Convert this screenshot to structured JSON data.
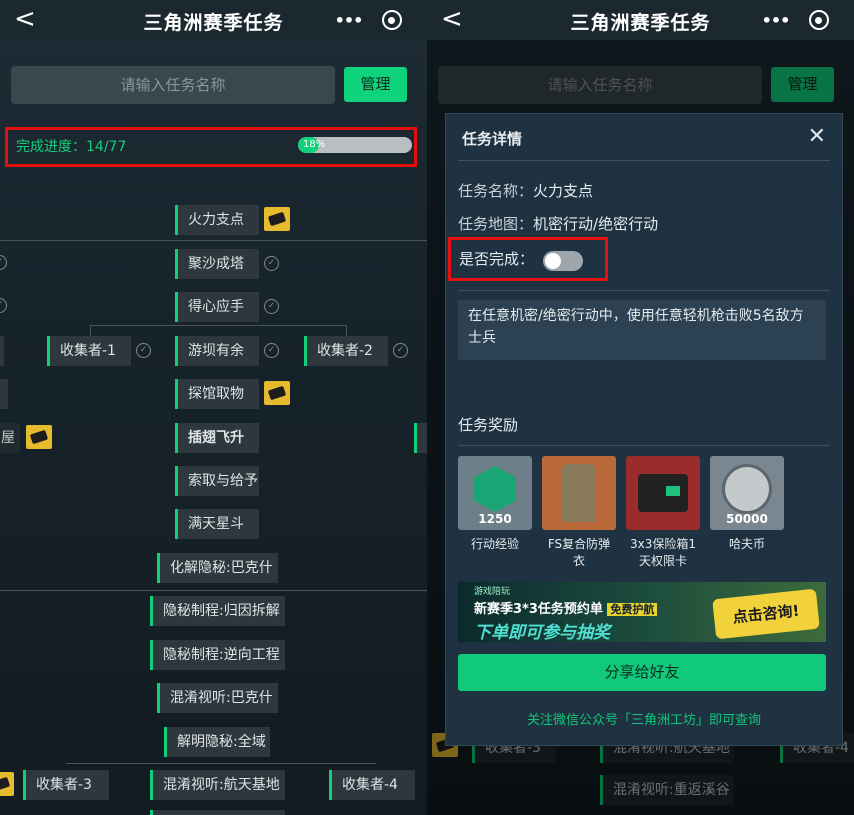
{
  "left": {
    "header": {
      "title": "三角洲赛季任务",
      "back": "<",
      "more": "•••"
    },
    "search_placeholder": "请输入任务名称",
    "manage_label": "管理",
    "progress_label": "完成进度：14/77",
    "progress_pct_label": "18%",
    "progress_value": 0.18,
    "nodes": [
      "火力支点",
      "聚沙成塔",
      "得心应手",
      "收集者-1",
      "游坝有余",
      "收集者-2",
      "探馆取物",
      "插翅飞升",
      "索取与给予",
      "满天星斗",
      "化解隐秘:巴克什",
      "隐秘制程:归因拆解",
      "隐秘制程:逆向工程",
      "混淆视听:巴克什",
      "解明隐秘:全域",
      "收集者-3",
      "混淆视听:航天基地",
      "收集者-4"
    ],
    "edge_text": [
      "屋"
    ]
  },
  "right": {
    "header": {
      "title": "三角洲赛季任务",
      "back": "<",
      "more": "•••"
    },
    "search_placeholder": "请输入任务名称",
    "manage_label": "管理",
    "behind": [
      "收集者-3",
      "混淆视听:航天基地",
      "收集者-4",
      "混淆视听:重返溪谷"
    ],
    "modal": {
      "title": "任务详情",
      "name_key": "任务名称：",
      "name_val": "火力支点",
      "map_key": "任务地图：",
      "map_val": "机密行动/绝密行动",
      "done_key": "是否完成：",
      "done": false,
      "description": "在任意机密/绝密行动中，使用任意轻机枪击败5名敌方士兵",
      "rewards_title": "任务奖励",
      "rewards": [
        {
          "name": "行动经验",
          "amount": "1250"
        },
        {
          "name": "FS复合防弹衣",
          "amount": ""
        },
        {
          "name": "3x3保险箱1天权限卡",
          "amount": ""
        },
        {
          "name": "哈夫币",
          "amount": "50000"
        }
      ],
      "banner": {
        "small": "游戏陪玩",
        "line1": "新赛季3*3任务预约单",
        "line1_badge": "免费护航",
        "line2": "下单即可参与抽奖",
        "cta": "点击咨询!"
      },
      "share_label": "分享给好友",
      "follow_text": "关注微信公众号「三角洲工坊」即可查询"
    }
  },
  "colors": {
    "accent": "#12cf7b",
    "highlight": "#e41010",
    "bg": "#17232b"
  }
}
